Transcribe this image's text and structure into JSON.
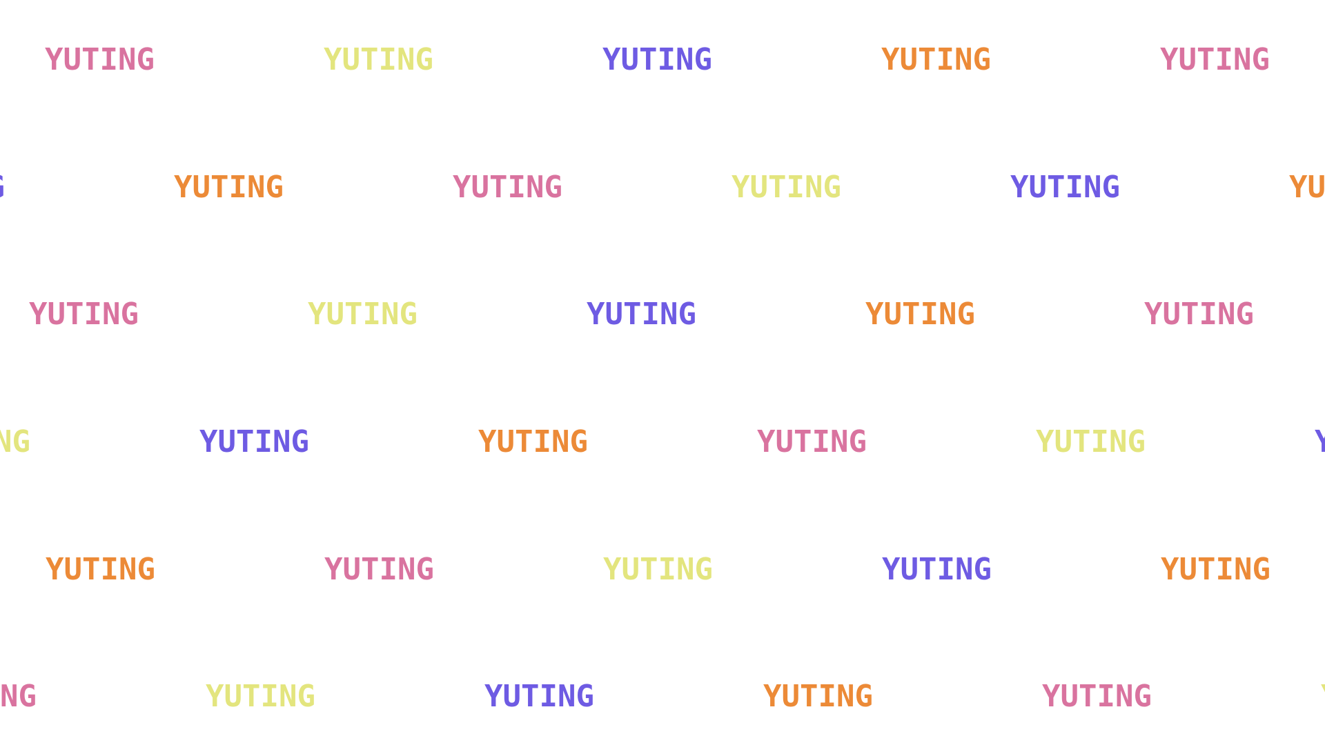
{
  "word": "YUTING",
  "palette": {
    "pink": "#d9739f",
    "yellow": "#e3e57e",
    "blue": "#6e5be3",
    "orange": "#ec8a37"
  },
  "rows": [
    {
      "colors": [
        "pink",
        "yellow",
        "blue",
        "orange",
        "pink"
      ]
    },
    {
      "colors": [
        "blue",
        "orange",
        "pink",
        "yellow",
        "blue",
        "orange"
      ]
    },
    {
      "colors": [
        "pink",
        "yellow",
        "blue",
        "orange",
        "pink"
      ]
    },
    {
      "colors": [
        "yellow",
        "blue",
        "orange",
        "pink",
        "yellow",
        "blue"
      ]
    },
    {
      "colors": [
        "orange",
        "pink",
        "yellow",
        "blue",
        "orange"
      ]
    },
    {
      "colors": [
        "pink",
        "yellow",
        "blue",
        "orange",
        "pink",
        "yellow"
      ]
    }
  ]
}
